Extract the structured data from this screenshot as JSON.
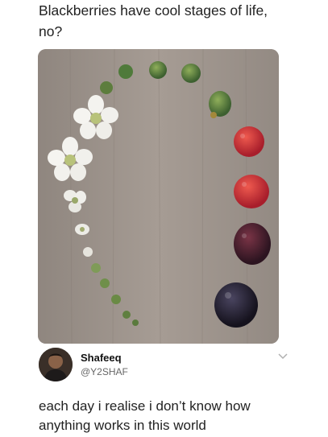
{
  "caption": {
    "line1": "Blackberries have cool stages of life,",
    "line2": "no?"
  },
  "tweet": {
    "author_name": "Shafeeq",
    "author_handle": "@Y2SHAF",
    "text_line1": "each day i realise i don’t know how",
    "text_line2": "anything works in this world"
  },
  "icons": {
    "menu": "chevron-down-icon",
    "avatar": "avatar"
  },
  "colors": {
    "wood": "#9b918a",
    "text": "#222222",
    "handle": "#666666",
    "berry_dark": "#1e1b2a",
    "berry_red": "#c8333a",
    "berry_green": "#4f7a3a"
  }
}
